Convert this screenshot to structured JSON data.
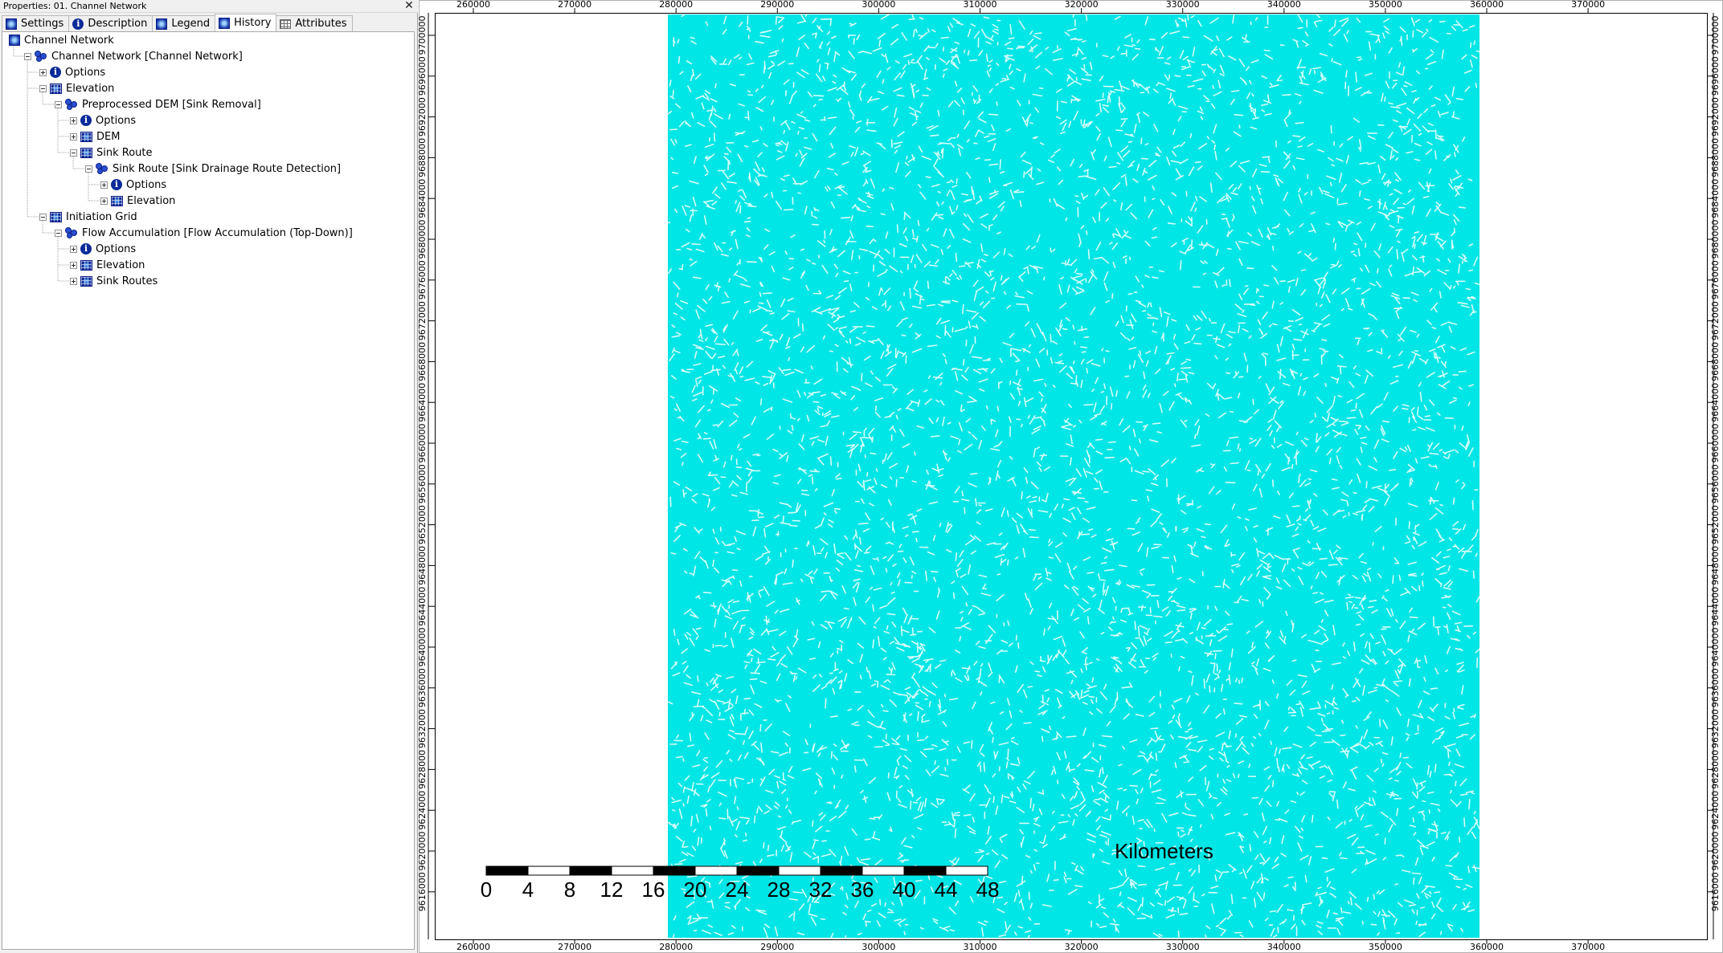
{
  "properties": {
    "title": "Properties: 01. Channel Network",
    "close_glyph": "✕",
    "tabs": [
      {
        "label": "Settings",
        "icon": "settings-icon"
      },
      {
        "label": "Description",
        "icon": "info-icon"
      },
      {
        "label": "Legend",
        "icon": "legend-icon"
      },
      {
        "label": "History",
        "icon": "history-icon",
        "active": true
      },
      {
        "label": "Attributes",
        "icon": "table-icon"
      }
    ],
    "tree": [
      {
        "label": "Channel Network",
        "level": 0,
        "icon": "square",
        "toggle": "none"
      },
      {
        "label": "Channel Network [Channel Network]",
        "level": 1,
        "icon": "tool",
        "toggle": "minus"
      },
      {
        "label": "Options",
        "level": 2,
        "icon": "info",
        "toggle": "plus"
      },
      {
        "label": "Elevation",
        "level": 2,
        "icon": "grid",
        "toggle": "minus"
      },
      {
        "label": "Preprocessed DEM [Sink Removal]",
        "level": 3,
        "icon": "tool",
        "toggle": "minus"
      },
      {
        "label": "Options",
        "level": 4,
        "icon": "info",
        "toggle": "plus"
      },
      {
        "label": "DEM",
        "level": 4,
        "icon": "grid",
        "toggle": "plus"
      },
      {
        "label": "Sink Route",
        "level": 4,
        "icon": "grid",
        "toggle": "minus"
      },
      {
        "label": "Sink Route [Sink Drainage Route Detection]",
        "level": 5,
        "icon": "tool",
        "toggle": "minus"
      },
      {
        "label": "Options",
        "level": 6,
        "icon": "info",
        "toggle": "plus"
      },
      {
        "label": "Elevation",
        "level": 6,
        "icon": "grid",
        "toggle": "plus"
      },
      {
        "label": "Initiation Grid",
        "level": 2,
        "icon": "grid",
        "toggle": "minus"
      },
      {
        "label": "Flow Accumulation [Flow Accumulation (Top-Down)]",
        "level": 3,
        "icon": "tool",
        "toggle": "minus"
      },
      {
        "label": "Options",
        "level": 4,
        "icon": "info",
        "toggle": "plus"
      },
      {
        "label": "Elevation",
        "level": 4,
        "icon": "grid",
        "toggle": "plus"
      },
      {
        "label": "Sink Routes",
        "level": 4,
        "icon": "grid",
        "toggle": "plus"
      }
    ]
  },
  "map": {
    "layer_color": "#00e5e5",
    "x_ticks": [
      "260000",
      "270000",
      "280000",
      "290000",
      "300000",
      "310000",
      "320000",
      "330000",
      "340000",
      "350000",
      "360000",
      "370000"
    ],
    "y_ticks": [
      "9700000",
      "9696000",
      "9692000",
      "9688000",
      "9684000",
      "9680000",
      "9676000",
      "9672000",
      "9668000",
      "9664000",
      "9660000",
      "9656000",
      "9652000",
      "9648000",
      "9644000",
      "9640000",
      "9636000",
      "9632000",
      "9628000",
      "9624000",
      "9620000",
      "9616000"
    ],
    "scalebar": {
      "title": "Kilometers",
      "labels": [
        "0",
        "4",
        "8",
        "12",
        "16",
        "20",
        "24",
        "28",
        "32",
        "36",
        "40",
        "44",
        "48"
      ]
    }
  }
}
